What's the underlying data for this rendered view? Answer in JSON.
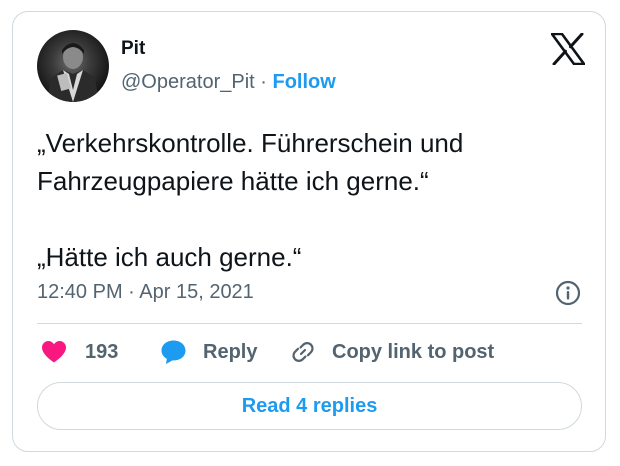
{
  "author": {
    "name": "Pit",
    "handle": "@Operator_Pit",
    "separator": "·",
    "follow_label": "Follow"
  },
  "tweet": {
    "paragraphs": [
      "„Verkehrskontrolle. Führerschein und Fahrzeugpapiere hätte ich gerne.“",
      "„Hätte ich auch gerne.“"
    ],
    "timestamp": "12:40 PM · Apr 15, 2021"
  },
  "actions": {
    "like_count": "193",
    "reply_label": "Reply",
    "copy_link_label": "Copy link to post"
  },
  "read_replies_label": "Read 4 replies",
  "colors": {
    "accent": "#1d9bf0",
    "heart": "#f91880",
    "text": "#0f1419",
    "muted": "#536471",
    "border": "#cfd9de"
  },
  "icons": [
    "x-logo-icon",
    "info-icon",
    "heart-icon",
    "reply-bubble-icon",
    "link-icon"
  ]
}
